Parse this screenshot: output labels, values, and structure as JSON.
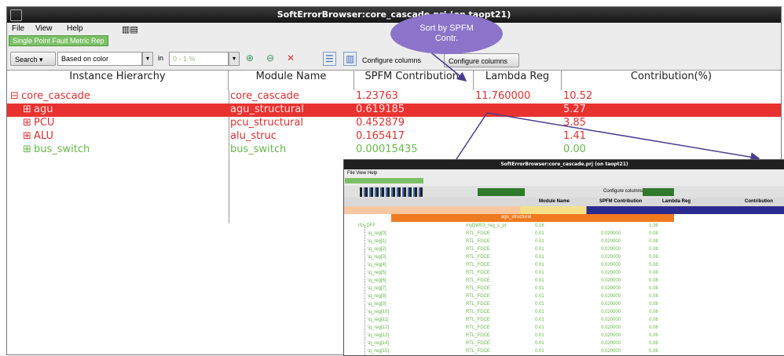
{
  "window": {
    "title": "SoftErrorBrowser:core_cascade.prj (on taopt21)"
  },
  "menu": {
    "file": "File",
    "view": "View",
    "help": "Help"
  },
  "tab": {
    "label": "Single Point Fault Metric Rep"
  },
  "toolbar": {
    "search_label": "Search",
    "based_on": "Based on color",
    "in_label": "in",
    "range_value": "0 - 1 %",
    "configure_text": "Configure columns",
    "configure_button": "Configure columns"
  },
  "tooltip": {
    "line1": "Sort by SPFM",
    "line2": "Contr."
  },
  "table": {
    "headers": [
      "Instance Hierarchy",
      "Module Name",
      "SPFM Contribution",
      "Lambda Reg",
      "Contribution(%)"
    ],
    "rows": [
      {
        "instance": "core_cascade",
        "module": "core_cascade",
        "spfm": "1.23763",
        "lambda": "11.760000",
        "contribution": "10.52",
        "expander": "⊟",
        "color": "red"
      },
      {
        "instance": "agu",
        "module": "agu_structural",
        "spfm": "0.619185",
        "lambda": "",
        "contribution": "5.27",
        "expander": "⊞",
        "color": "selected"
      },
      {
        "instance": "PCU",
        "module": "pcu_structural",
        "spfm": "0.452879",
        "lambda": "",
        "contribution": "3.85",
        "expander": "⊞",
        "color": "red"
      },
      {
        "instance": "ALU",
        "module": "alu_struc",
        "spfm": "0.165417",
        "lambda": "",
        "contribution": "1.41",
        "expander": "⊞",
        "color": "red"
      },
      {
        "instance": "bus_switch",
        "module": "bus_switch",
        "spfm": "0.00015435",
        "lambda": "",
        "contribution": "0.00",
        "expander": "⊞",
        "color": "green"
      }
    ]
  },
  "inset": {
    "title": "SoftErrorBrowser:core_cascade.prj (on taopt21)",
    "menu": "File  View  Help",
    "configure": "Configure columns",
    "headers": {
      "module": "Module Name",
      "spfm": "SPFM Contribution",
      "lambda": "Lambda Reg",
      "contrib": "Contribution"
    },
    "selected_row": "agu_structural",
    "first_row": {
      "instance": "rfd_DFF",
      "module": "myDW03_reg_s_pl",
      "spfm": "0.16",
      "lambda": "",
      "contrib": "1.36"
    },
    "rows": [
      {
        "instance": "\\q_reg[0]",
        "module": "RTL_FDCE",
        "spfm": "0.01",
        "lambda": "0.020000",
        "contrib": "0.08"
      },
      {
        "instance": "\\q_reg[1]",
        "module": "RTL_FDCE",
        "spfm": "0.01",
        "lambda": "0.020000",
        "contrib": "0.08"
      },
      {
        "instance": "\\q_reg[2]",
        "module": "RTL_FDCE",
        "spfm": "0.01",
        "lambda": "0.020000",
        "contrib": "0.08"
      },
      {
        "instance": "\\q_reg[3]",
        "module": "RTL_FDCE",
        "spfm": "0.01",
        "lambda": "0.020000",
        "contrib": "0.08"
      },
      {
        "instance": "\\q_reg[4]",
        "module": "RTL_FDCE",
        "spfm": "0.01",
        "lambda": "0.020000",
        "contrib": "0.08"
      },
      {
        "instance": "\\q_reg[5]",
        "module": "RTL_FDCE",
        "spfm": "0.01",
        "lambda": "0.020000",
        "contrib": "0.08"
      },
      {
        "instance": "\\q_reg[6]",
        "module": "RTL_FDCE",
        "spfm": "0.01",
        "lambda": "0.020000",
        "contrib": "0.08"
      },
      {
        "instance": "\\q_reg[7]",
        "module": "RTL_FDCE",
        "spfm": "0.01",
        "lambda": "0.020000",
        "contrib": "0.08"
      },
      {
        "instance": "\\q_reg[8]",
        "module": "RTL_FDCE",
        "spfm": "0.01",
        "lambda": "0.020000",
        "contrib": "0.08"
      },
      {
        "instance": "\\q_reg[9]",
        "module": "RTL_FDCE",
        "spfm": "0.01",
        "lambda": "0.020000",
        "contrib": "0.08"
      },
      {
        "instance": "\\q_reg[10]",
        "module": "RTL_FDCE",
        "spfm": "0.01",
        "lambda": "0.020000",
        "contrib": "0.08"
      },
      {
        "instance": "\\q_reg[11]",
        "module": "RTL_FDCE",
        "spfm": "0.01",
        "lambda": "0.020000",
        "contrib": "0.08"
      },
      {
        "instance": "\\q_reg[12]",
        "module": "RTL_FDCE",
        "spfm": "0.01",
        "lambda": "0.020000",
        "contrib": "0.08"
      },
      {
        "instance": "\\q_reg[13]",
        "module": "RTL_FDCE",
        "spfm": "0.01",
        "lambda": "0.020000",
        "contrib": "0.08"
      },
      {
        "instance": "\\q_reg[14]",
        "module": "RTL_FDCE",
        "spfm": "0.01",
        "lambda": "0.020000",
        "contrib": "0.08"
      },
      {
        "instance": "\\q_reg[15]",
        "module": "RTL_FDCE",
        "spfm": "0.01",
        "lambda": "0.020000",
        "contrib": "0.08"
      }
    ]
  },
  "colors": {
    "red": "#e03030",
    "green": "#66b84a",
    "selection": "#e8322f",
    "tooltip": "#8b74c9",
    "arrow": "#4a3d8f"
  },
  "icons": {
    "expand": "plus-box-icon",
    "collapse": "minus-box-icon",
    "delete": "red-x-icon",
    "zoom_in": "zoom-in-icon",
    "zoom_out": "zoom-out-icon"
  }
}
